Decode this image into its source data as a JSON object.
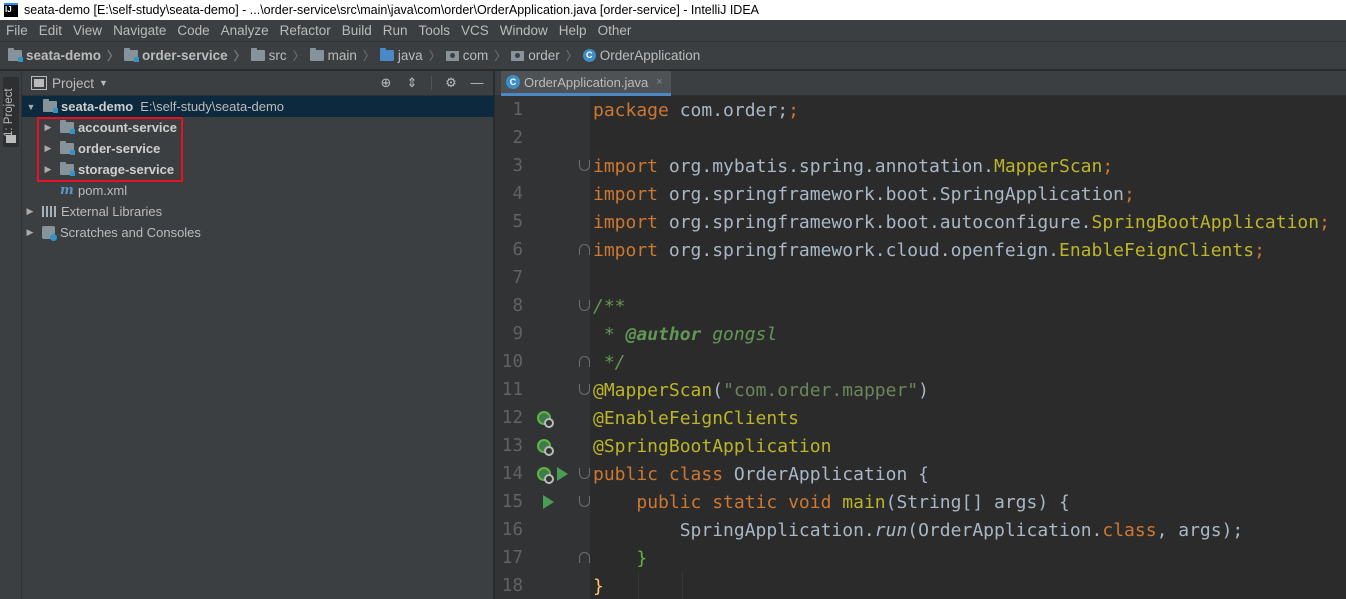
{
  "window": {
    "title": "seata-demo [E:\\self-study\\seata-demo] - ...\\order-service\\src\\main\\java\\com\\order\\OrderApplication.java [order-service] - IntelliJ IDEA",
    "app_icon": "IJ"
  },
  "menu": [
    "File",
    "Edit",
    "View",
    "Navigate",
    "Code",
    "Analyze",
    "Refactor",
    "Build",
    "Run",
    "Tools",
    "VCS",
    "Window",
    "Help",
    "Other"
  ],
  "breadcrumb": [
    "seata-demo",
    "order-service",
    "src",
    "main",
    "java",
    "com",
    "order",
    "OrderApplication"
  ],
  "toolstrip": {
    "project_tab": "1: Project"
  },
  "project_panel": {
    "title": "Project",
    "tools": [
      "locate-icon",
      "collapse-icon",
      "gear-icon",
      "minimize-icon"
    ],
    "root": {
      "name": "seata-demo",
      "path": "E:\\self-study\\seata-demo"
    },
    "modules": [
      "account-service",
      "order-service",
      "storage-service"
    ],
    "pom": "pom.xml",
    "external_libraries": "External Libraries",
    "scratches": "Scratches and Consoles"
  },
  "editor": {
    "tab": "OrderApplication.java",
    "tab_close": "×",
    "line_numbers": [
      "1",
      "2",
      "3",
      "4",
      "5",
      "6",
      "7",
      "8",
      "9",
      "10",
      "11",
      "12",
      "13",
      "14",
      "15",
      "16",
      "17",
      "18"
    ],
    "lines": {
      "l1_kw": "package",
      "l1_rest": " com.order;",
      "l3_kw": "import",
      "l3_a": " org.mybatis.spring.annotation.",
      "l3_b": "MapperScan",
      "l3_c": ";",
      "l4_kw": "import",
      "l4_a": " org.springframework.boot.SpringApplication",
      "l4_c": ";",
      "l5_kw": "import",
      "l5_a": " org.springframework.boot.autoconfigure.",
      "l5_b": "SpringBootApplication",
      "l5_c": ";",
      "l6_kw": "import",
      "l6_a": " org.springframework.cloud.openfeign.",
      "l6_b": "EnableFeignClients",
      "l6_c": ";",
      "l8": "/**",
      "l9_a": " * ",
      "l9_tag": "@author",
      "l9_b": " gongsl",
      "l10": " */",
      "l11_ann": "@MapperScan",
      "l11_p1": "(",
      "l11_str": "\"com.order.mapper\"",
      "l11_p2": ")",
      "l12_ann": "@EnableFeignClients",
      "l13_ann": "@SpringBootApplication",
      "l14_kw": "public class",
      "l14_rest": " OrderApplication {",
      "l15_kw": "public static void",
      "l15_name": " main",
      "l15_rest": "(String[] args) {",
      "l16_a": "SpringApplication.",
      "l16_run": "run",
      "l16_b": "(OrderApplication.",
      "l16_kw": "class",
      "l16_c": ", args);",
      "l17": "}",
      "l18": "}"
    }
  },
  "colors": {
    "keyword": "#cc7832",
    "annotation": "#bbb529",
    "string": "#6a8759",
    "doc_comment": "#629755",
    "highlight_box": "#e81123"
  }
}
